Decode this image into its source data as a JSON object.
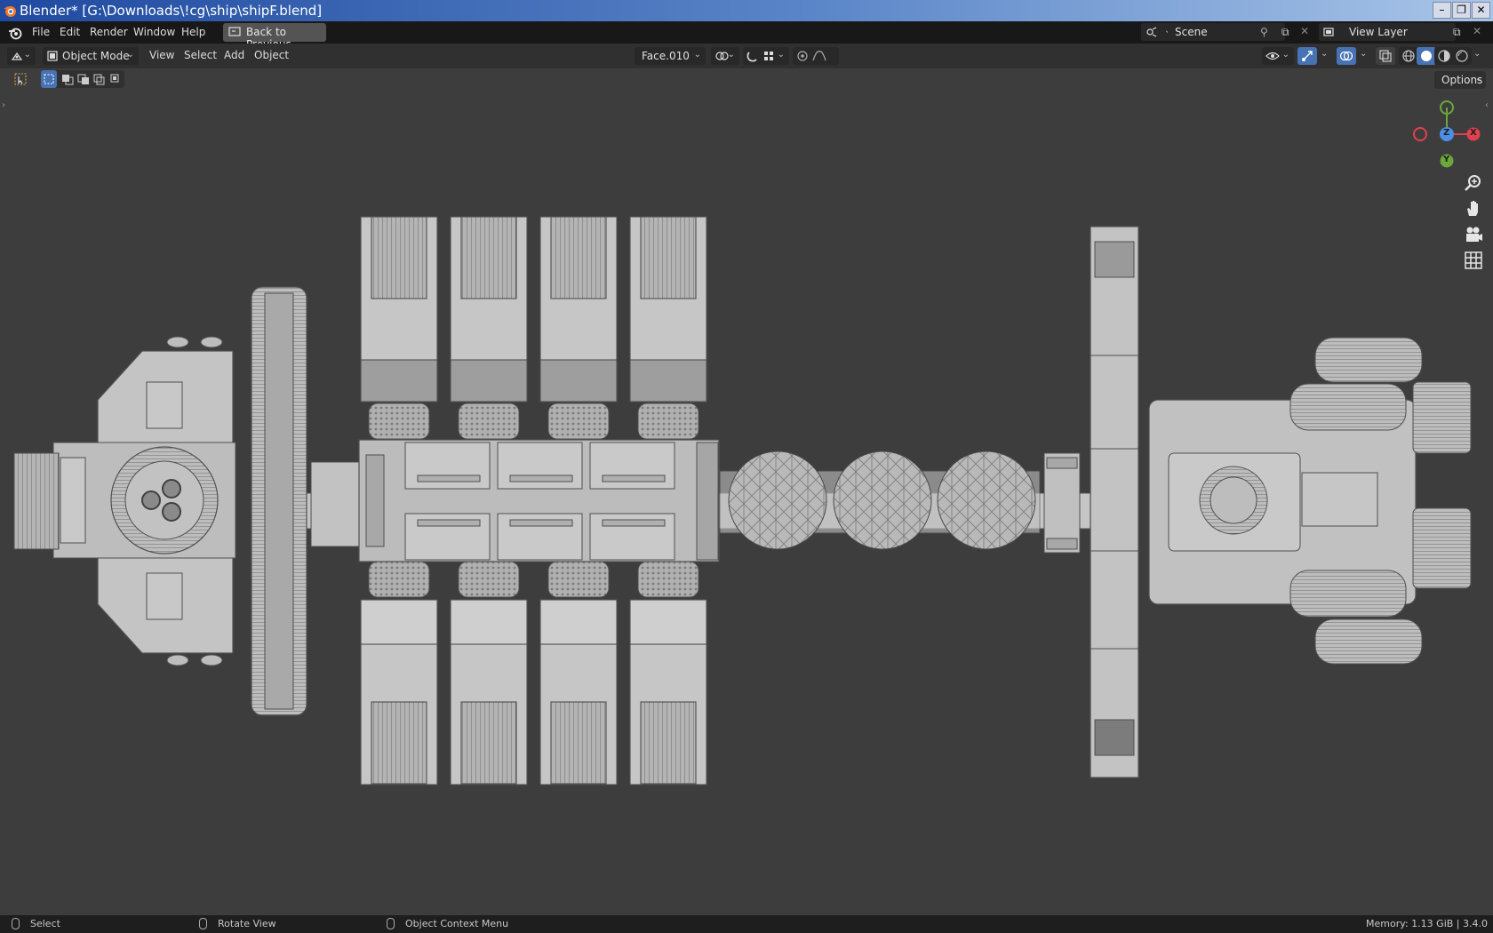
{
  "window": {
    "title": "Blender* [G:\\Downloads\\!cg\\ship\\shipF.blend]"
  },
  "topbar": {
    "menus": [
      "File",
      "Edit",
      "Render",
      "Window",
      "Help"
    ],
    "back_button": "Back to Previous",
    "scene": "Scene",
    "view_layer": "View Layer"
  },
  "viewport_header": {
    "mode": "Object Mode",
    "menus": [
      "View",
      "Select",
      "Add",
      "Object"
    ],
    "orientation": "Face.010"
  },
  "tool_row": {
    "options": "Options"
  },
  "gizmo": {
    "x_label": "X",
    "y_label": "Y",
    "z_label": "Z",
    "colors": {
      "x": "#e0414f",
      "y": "#6ba73a",
      "z": "#4d8fe6"
    }
  },
  "statusbar": {
    "select": "Select",
    "rotate": "Rotate View",
    "context": "Object Context Menu",
    "memory": "Memory: 1.13 GiB | 3.4.0"
  },
  "icons": [
    "blender-logo-icon",
    "editor-type-icon",
    "object-mode-icon",
    "transform-pivot-icon",
    "snap-icon",
    "proportional-edit-icon",
    "visibility-icon",
    "gizmo-icon",
    "overlay-icon",
    "xray-icon",
    "wireframe-shading-icon",
    "solid-shading-icon",
    "material-shading-icon",
    "rendered-shading-icon",
    "zoom-icon",
    "pan-hand-icon",
    "camera-icon",
    "grid-icon"
  ]
}
